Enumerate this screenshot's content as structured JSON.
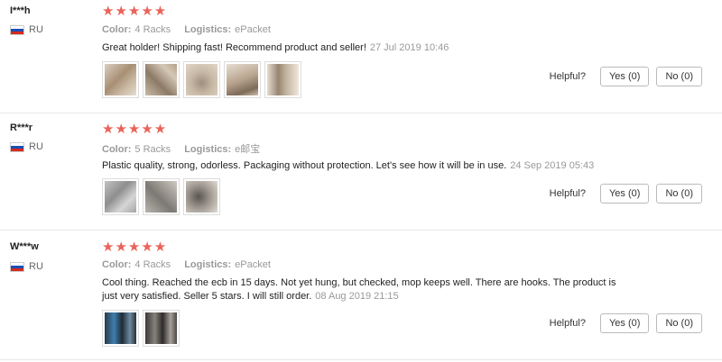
{
  "reviews": [
    {
      "user": "I***h",
      "country": "RU",
      "stars": "★★★★★",
      "color_label": "Color:",
      "color_value": "4 Racks",
      "logistics_label": "Logistics:",
      "logistics_value": "ePacket",
      "text": "Great holder! Shipping fast! Recommend product and seller!",
      "date": "27 Jul 2019 10:46",
      "photos": [
        "rack-photo-1",
        "rack-photo-2",
        "rack-photo-3",
        "rack-photo-4",
        "rack-photo-5"
      ],
      "helpful_label": "Helpful?",
      "yes_label": "Yes (0)",
      "no_label": "No (0)"
    },
    {
      "user": "R***r",
      "country": "RU",
      "stars": "★★★★★",
      "color_label": "Color:",
      "color_value": "5 Racks",
      "logistics_label": "Logistics:",
      "logistics_value": "e邮宝",
      "text": "Plastic quality, strong, odorless. Packaging without protection. Let's see how it will be in use.",
      "date": "24 Sep 2019 05:43",
      "photos": [
        "package-photo",
        "holder-photo",
        "hook-photo"
      ],
      "helpful_label": "Helpful?",
      "yes_label": "Yes (0)",
      "no_label": "No (0)"
    },
    {
      "user": "W***w",
      "country": "RU",
      "stars": "★★★★★",
      "color_label": "Color:",
      "color_value": "4 Racks",
      "logistics_label": "Logistics:",
      "logistics_value": "ePacket",
      "text": "Cool thing. Reached the ecb in 15 days. Not yet hung, but checked, mop keeps well. There are hooks. The product is just very satisfied. Seller 5 stars. I will still order.",
      "date": "08 Aug 2019 21:15",
      "photos": [
        "mop-photo",
        "clip-photo"
      ],
      "helpful_label": "Helpful?",
      "yes_label": "Yes (0)",
      "no_label": "No (0)"
    }
  ],
  "colors": {
    "star": "#e8645a",
    "muted": "#999999",
    "divider": "#e8e8e8"
  }
}
